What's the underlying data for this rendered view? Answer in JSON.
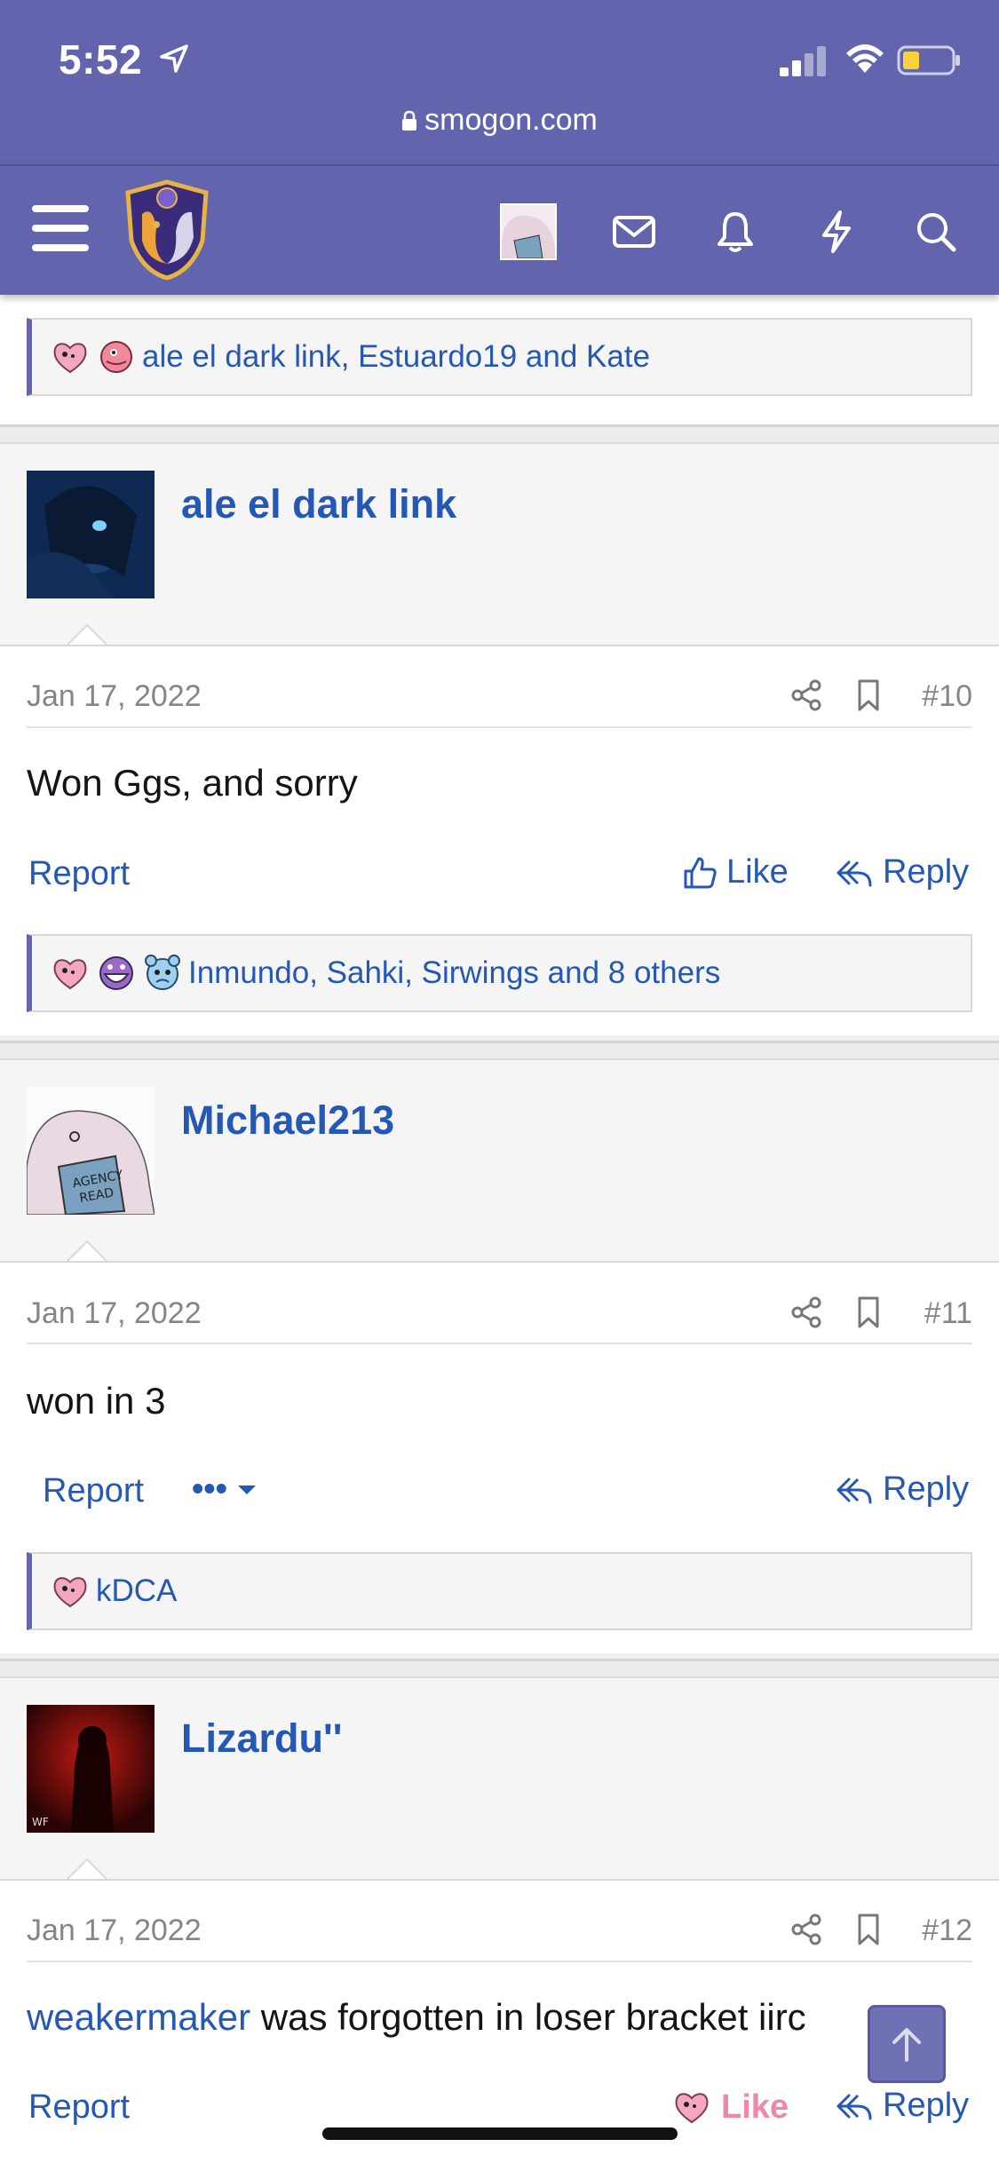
{
  "status_bar": {
    "time": "5:52",
    "url": "smogon.com"
  },
  "nav": {
    "icons": [
      "menu-icon",
      "smogon-logo",
      "user-avatar",
      "mail-icon",
      "bell-icon",
      "bolt-icon",
      "search-icon"
    ]
  },
  "colors": {
    "brand": "#6265ad",
    "link": "#2557b5",
    "like_active": "#ef87a8"
  },
  "top_reactions": {
    "text": "ale el dark link, Estuardo19 and Kate"
  },
  "posts": [
    {
      "username": "ale el dark link",
      "date": "Jan 17, 2022",
      "number": "#10",
      "message": "Won Ggs, and sorry",
      "actions": {
        "report": "Report",
        "like": "Like",
        "reply": "Reply"
      },
      "reactions": "Inmundo, Sahki, Sirwings and 8 others"
    },
    {
      "username": "Michael213",
      "date": "Jan 17, 2022",
      "number": "#11",
      "message": "won in 3",
      "actions": {
        "report": "Report",
        "more": "•••",
        "reply": "Reply"
      },
      "reactions": "kDCA"
    },
    {
      "username": "Lizardu''",
      "date": "Jan 17, 2022",
      "number": "#12",
      "message_mention": "weakermaker",
      "message": " was forgotten in loser bracket iirc",
      "actions": {
        "report": "Report",
        "like": "Like",
        "reply": "Reply"
      }
    }
  ]
}
